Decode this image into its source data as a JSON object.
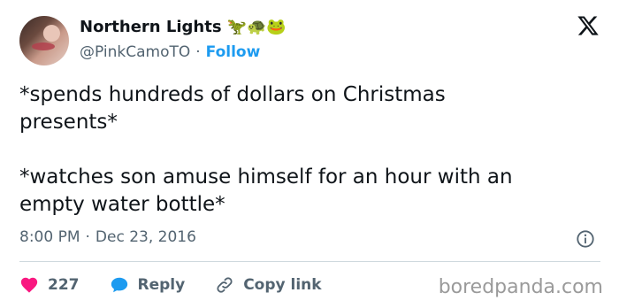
{
  "author": {
    "display_name": "Northern Lights",
    "emojis": "🦖🐢🐸",
    "handle": "@PinkCamoTO",
    "separator": "·",
    "follow_label": "Follow"
  },
  "tweet": {
    "text": "*spends hundreds of dollars on Christmas\npresents*\n\n*watches son amuse himself for an hour with an\nempty water bottle*",
    "time": "8:00 PM",
    "separator": "·",
    "date": "Dec 23, 2016"
  },
  "actions": {
    "likes_count": "227",
    "reply_label": "Reply",
    "copy_link_label": "Copy link"
  },
  "watermark": "boredpanda.com",
  "colors": {
    "like": "#f91880",
    "reply": "#1d9bf0",
    "follow": "#1d9bf0",
    "muted": "#536471"
  },
  "icons": [
    "x-logo-icon",
    "info-icon",
    "heart-icon",
    "speech-bubble-icon",
    "link-icon"
  ]
}
